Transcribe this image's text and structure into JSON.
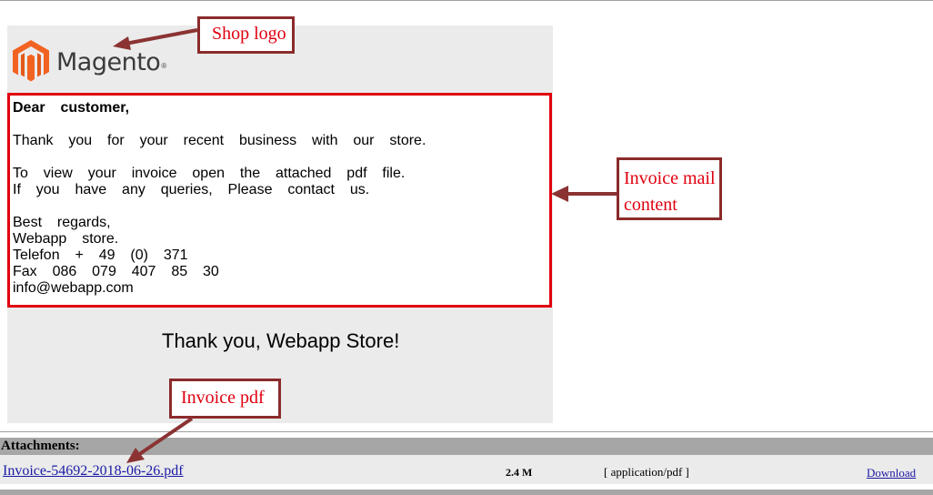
{
  "logo": {
    "brand": "Magento",
    "registered": "®",
    "icon": "magento-logo-icon"
  },
  "email": {
    "greeting": "Dear  customer,",
    "line_thanks": "Thank  you  for  your  recent  business  with  our  store.",
    "line_view": "To  view  your  invoice  open  the  attached  pdf  file.",
    "line_queries": "If  you  have  any  queries,  Please  contact  us.",
    "regards": "Best  regards,",
    "store_name": "Webapp  store.",
    "telefon": "Telefon  +  49  (0)  371",
    "fax": "Fax  086  079  407  85  30",
    "email_address": "info@webapp.com",
    "thank_you": "Thank you, Webapp Store!"
  },
  "attachments": {
    "header": "Attachments:",
    "items": [
      {
        "name": "Invoice-54692-2018-06-26.pdf",
        "size": "2.4 M",
        "type": "[ application/pdf ]",
        "action": "Download"
      }
    ]
  },
  "annotations": {
    "shop_logo": "Shop logo",
    "invoice_mail_line1": "Invoice mail",
    "invoice_mail_line2": "content",
    "invoice_pdf": "Invoice pdf"
  },
  "colors": {
    "highlight_border": "#e0000f",
    "callout_border": "#8b2b2b",
    "callout_text": "#e0000f",
    "link": "#1a1aa6",
    "magento_orange": "#f26322"
  }
}
